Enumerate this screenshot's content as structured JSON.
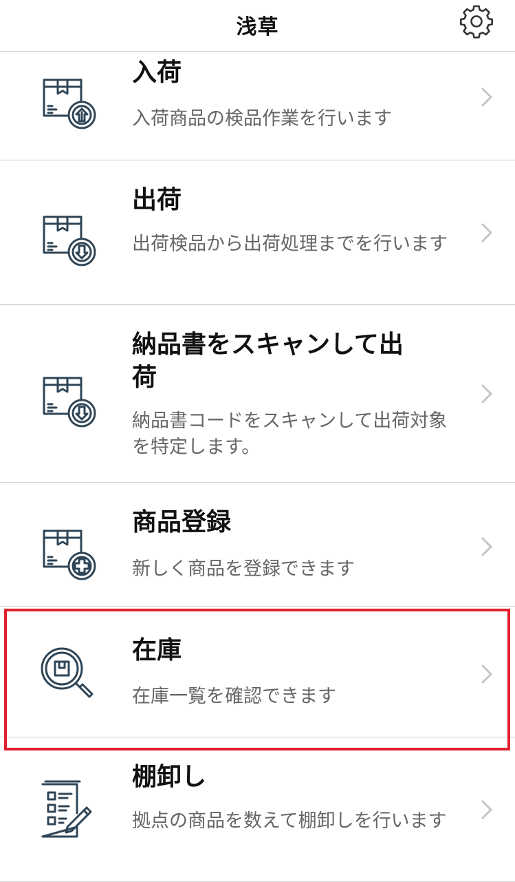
{
  "header": {
    "title": "浅草",
    "settings_icon": "gear-icon"
  },
  "menu": {
    "items": [
      {
        "title": "入荷",
        "description": "入荷商品の検品作業を行います",
        "icon": "box-arrow-up-icon"
      },
      {
        "title": "出荷",
        "description": "出荷検品から出荷処理までを行います",
        "icon": "box-arrow-down-icon"
      },
      {
        "title": "納品書をスキャンして出荷",
        "description": "納品書コードをスキャンして出荷対象を特定します。",
        "icon": "box-arrow-down-icon"
      },
      {
        "title": "商品登録",
        "description": "新しく商品を登録できます",
        "icon": "box-plus-icon"
      },
      {
        "title": "在庫",
        "description": "在庫一覧を確認できます",
        "icon": "magnifier-box-icon"
      },
      {
        "title": "棚卸し",
        "description": "拠点の商品を数えて棚卸しを行います",
        "icon": "checklist-pencil-icon"
      }
    ]
  },
  "colors": {
    "icon_stroke": "#2f4556",
    "highlight_border": "#e0202b",
    "description_text": "#666666",
    "divider": "#cfcfcf"
  }
}
